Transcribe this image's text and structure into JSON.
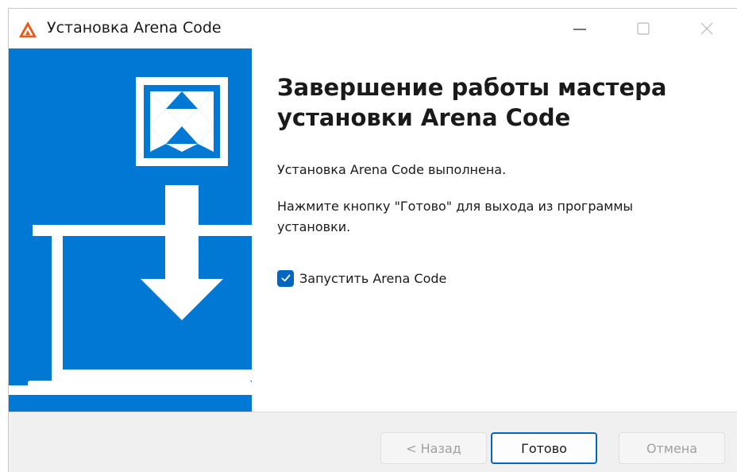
{
  "window": {
    "title": "Установка Arena Code",
    "icon": "arena-logo-icon",
    "controls": [
      "minimize-icon",
      "maximize-icon",
      "close-icon"
    ]
  },
  "content": {
    "heading": "Завершение работы мастера установки Arena Code",
    "message_done": "Установка Arena Code выполнена.",
    "message_instruction": "Нажмите кнопку \"Готово\" для выхода из программы установки.",
    "launch_checkbox": {
      "label": "Запустить Arena Code",
      "checked": true
    }
  },
  "footer": {
    "back_label": "< Назад",
    "finish_label": "Готово",
    "cancel_label": "Отмена"
  },
  "colors": {
    "accent": "#0078d4",
    "checkbox": "#0067c0",
    "logo": "#e8591a"
  }
}
